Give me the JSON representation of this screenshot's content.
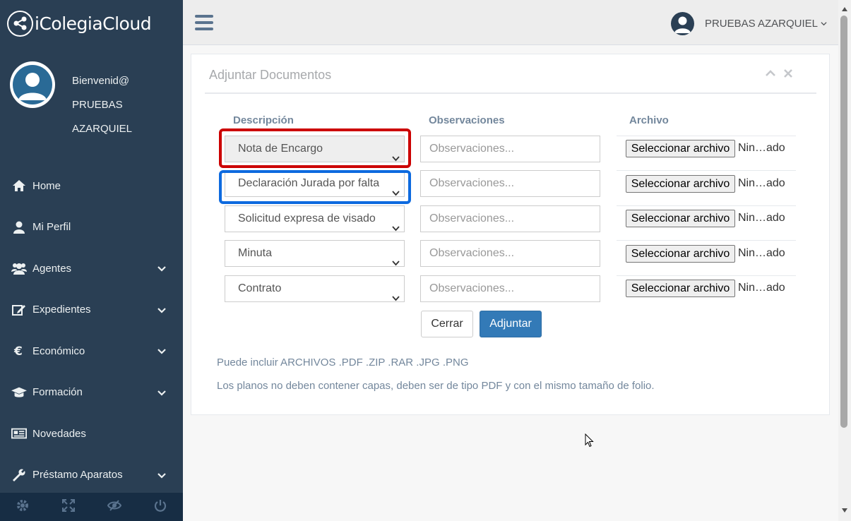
{
  "app": {
    "name": "iColegiaCloud",
    "user_display": "PRUEBAS AZARQUIEL",
    "colors": {
      "sidebar": "#2a3f54",
      "primary_button": "#337ab7",
      "highlight_red": "#cc0000",
      "highlight_blue": "#0d6adf"
    }
  },
  "sidebar": {
    "greeting": "Bienvenid@",
    "user_line1": "PRUEBAS",
    "user_line2": "AZARQUIEL",
    "items": [
      {
        "label": "Home",
        "icon": "home-icon",
        "has_submenu": false
      },
      {
        "label": "Mi Perfil",
        "icon": "user-icon",
        "has_submenu": false
      },
      {
        "label": "Agentes",
        "icon": "users-icon",
        "has_submenu": true
      },
      {
        "label": "Expedientes",
        "icon": "edit-icon",
        "has_submenu": true
      },
      {
        "label": "Económico",
        "icon": "euro-icon",
        "has_submenu": true
      },
      {
        "label": "Formación",
        "icon": "graduation-cap-icon",
        "has_submenu": true
      },
      {
        "label": "Novedades",
        "icon": "newspaper-icon",
        "has_submenu": false
      },
      {
        "label": "Préstamo Aparatos",
        "icon": "wrench-icon",
        "has_submenu": true
      }
    ],
    "footer_icons": [
      "settings-icon",
      "fullscreen-icon",
      "eye-slash-icon",
      "power-icon"
    ]
  },
  "panel": {
    "title": "Adjuntar Documentos",
    "columns": {
      "descripcion": "Descripción",
      "observaciones": "Observaciones",
      "archivo": "Archivo"
    },
    "rows": [
      {
        "descripcion": "Nota de Encargo",
        "observaciones_placeholder": "Observaciones...",
        "file_button": "Seleccionar archivo",
        "file_state": "Nin…ado"
      },
      {
        "descripcion": "Declaración Jurada por falta de",
        "observaciones_placeholder": "Observaciones...",
        "file_button": "Seleccionar archivo",
        "file_state": "Nin…ado"
      },
      {
        "descripcion": "Solicitud expresa de visado parcial",
        "observaciones_placeholder": "Observaciones...",
        "file_button": "Seleccionar archivo",
        "file_state": "Nin…ado"
      },
      {
        "descripcion": "Minuta",
        "observaciones_placeholder": "Observaciones...",
        "file_button": "Seleccionar archivo",
        "file_state": "Nin…ado"
      },
      {
        "descripcion": "Contrato",
        "observaciones_placeholder": "Observaciones...",
        "file_button": "Seleccionar archivo",
        "file_state": "Nin…ado"
      }
    ],
    "buttons": {
      "close": "Cerrar",
      "attach": "Adjuntar"
    },
    "notes": [
      "Puede incluir ARCHIVOS .PDF .ZIP .RAR .JPG .PNG",
      "Los planos no deben contener capas, deben ser de tipo PDF y con el mismo tamaño de folio."
    ]
  }
}
